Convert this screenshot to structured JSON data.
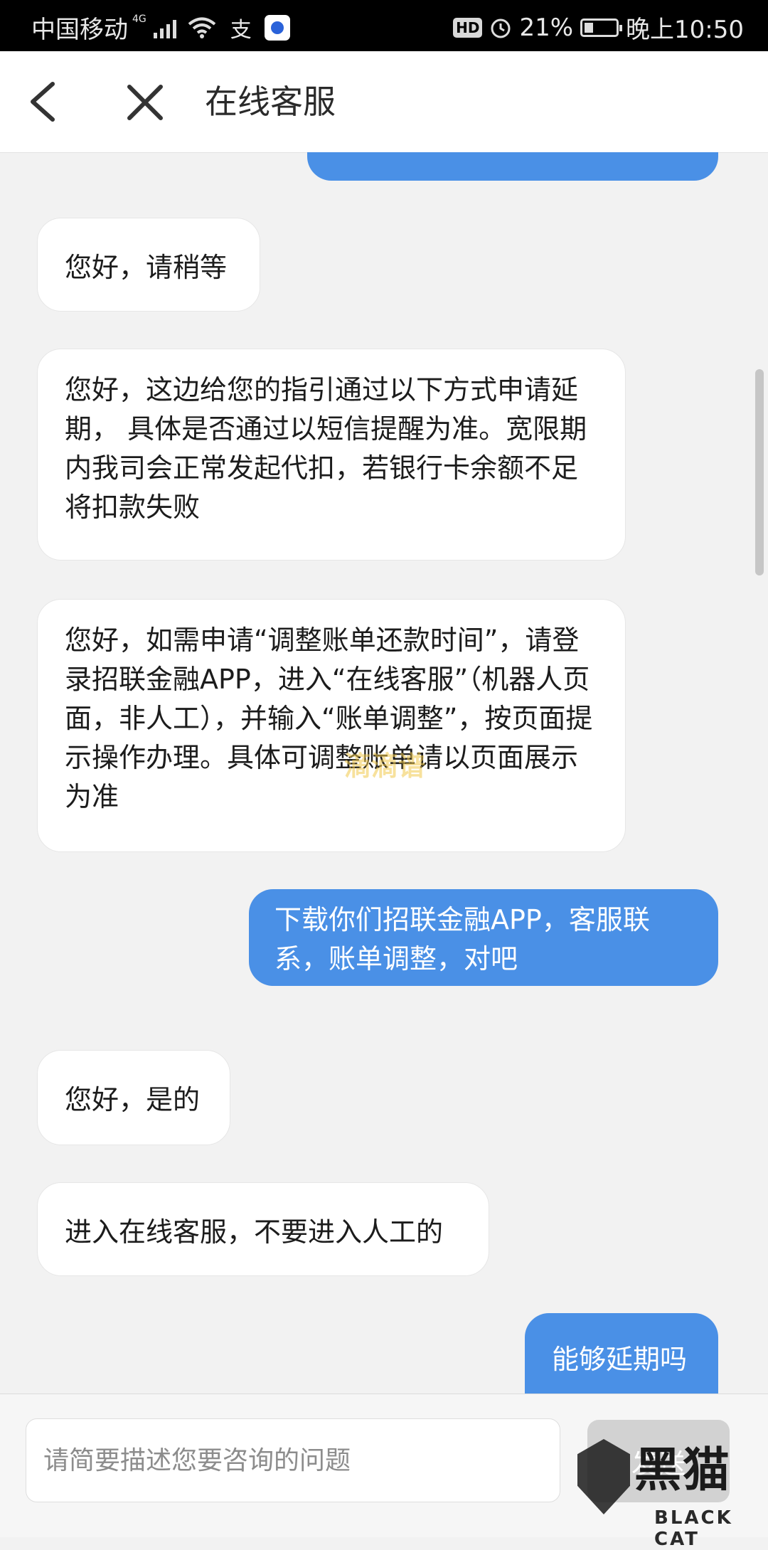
{
  "status_bar": {
    "carrier": "中国移动",
    "network": "4G",
    "alipay_glyph": "支",
    "hd_badge": "HD",
    "battery": "21%",
    "time": "晚上10:50"
  },
  "header": {
    "title": "在线客服"
  },
  "messages": [
    {
      "sender": "user",
      "text": ""
    },
    {
      "sender": "agent",
      "text": "您好，请稍等"
    },
    {
      "sender": "agent",
      "text": "您好，这边给您的指引通过以下方式申请延期， 具体是否通过以短信提醒为准。宽限期内我司会正常发起代扣，若银行卡余额不足将扣款失败"
    },
    {
      "sender": "agent",
      "text": "您好，如需申请“调整账单还款时间”，请登录招联金融APP，进入“在线客服”（机器人页面，非人工），并输入“账单调整”，按页面提示操作办理。具体可调整账单请以页面展示为准"
    },
    {
      "sender": "user",
      "text": "下载你们招联金融APP，客服联系，账单调整，对吧"
    },
    {
      "sender": "agent",
      "text": "您好，是的"
    },
    {
      "sender": "agent",
      "text": "进入在线客服，不要进入人工的"
    },
    {
      "sender": "user",
      "text": "能够延期吗"
    }
  ],
  "overlay_watermark": "滴滴谱",
  "input": {
    "placeholder": "请简要描述您要咨询的问题",
    "value": ""
  },
  "send_button": {
    "label": "发送"
  },
  "brand_watermark": {
    "cn": "黑猫",
    "en": "BLACK CAT"
  },
  "colors": {
    "user_bubble": "#4a90e6",
    "agent_bubble": "#ffffff",
    "background": "#f2f2f2",
    "send_button": "#d2d2d2"
  }
}
